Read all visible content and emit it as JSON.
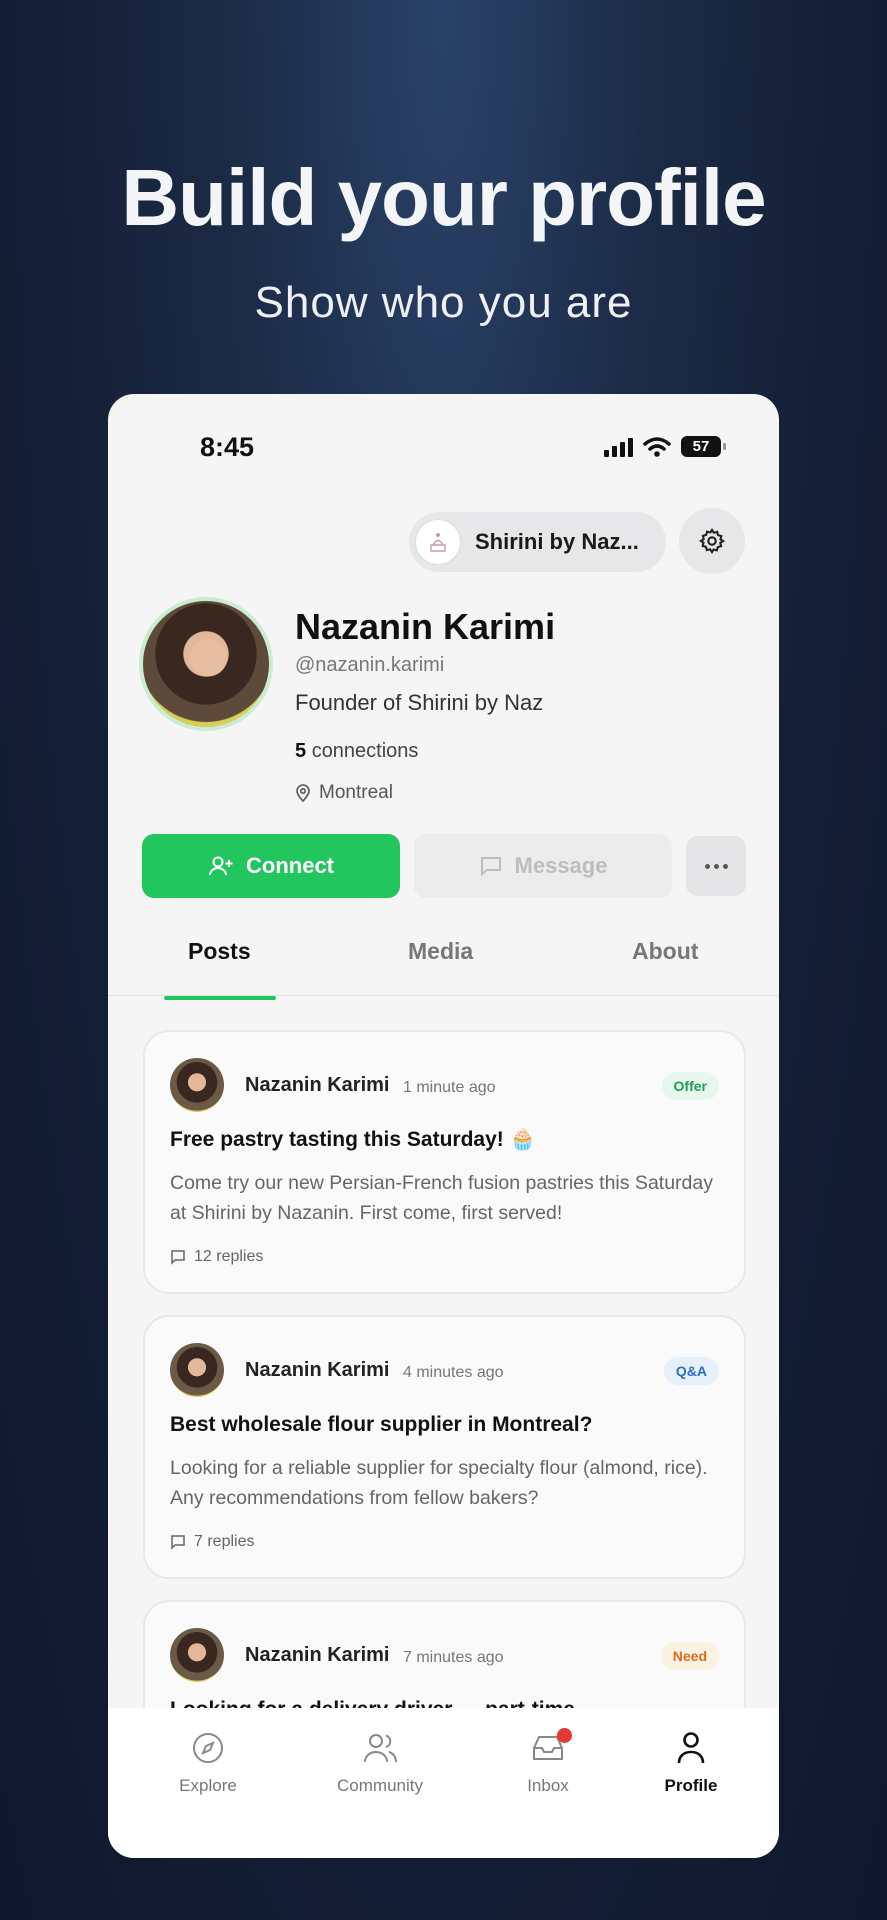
{
  "headline": "Build your profile",
  "subheadline": "Show who you are",
  "status_bar": {
    "time": "8:45",
    "battery": "57"
  },
  "header": {
    "business_name": "Shirini by Naz..."
  },
  "profile": {
    "name": "Nazanin Karimi",
    "handle": "@nazanin.karimi",
    "bio": "Founder of Shirini by Naz",
    "connections_count": "5",
    "connections_label": "connections",
    "location": "Montreal"
  },
  "actions": {
    "connect": "Connect",
    "message": "Message"
  },
  "tabs": [
    "Posts",
    "Media",
    "About"
  ],
  "active_tab": "Posts",
  "posts": [
    {
      "author": "Nazanin Karimi",
      "time": "1 minute ago",
      "badge": "Offer",
      "title": "Free pastry tasting this Saturday! 🧁",
      "body": "Come try our new Persian-French fusion pastries this Saturday at Shirini by Nazanin. First come, first served!",
      "replies": "12 replies"
    },
    {
      "author": "Nazanin Karimi",
      "time": "4 minutes ago",
      "badge": "Q&A",
      "title": "Best wholesale flour supplier in Montreal?",
      "body": "Looking for a reliable supplier for specialty flour (almond, rice). Any recommendations from fellow bakers?",
      "replies": "7 replies"
    },
    {
      "author": "Nazanin Karimi",
      "time": "7 minutes ago",
      "badge": "Need",
      "title": "Looking for a delivery driver — part-time"
    }
  ],
  "bottom_nav": [
    "Explore",
    "Community",
    "Inbox",
    "Profile"
  ],
  "colors": {
    "accent": "#22c55e",
    "background": "#131d33",
    "badge_offer": "#1f9d55",
    "badge_qa": "#2c6ec4",
    "badge_need": "#dd6b1f",
    "notification": "#e53935"
  }
}
